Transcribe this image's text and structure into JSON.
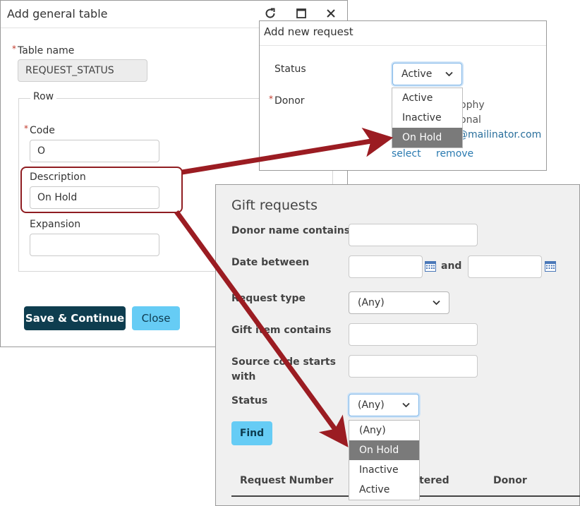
{
  "dialog1": {
    "title": "Add general table",
    "table_name_label": "Table name",
    "table_name_value": "REQUEST_STATUS",
    "row_legend": "Row",
    "code_label": "Code",
    "code_value": "O",
    "description_label": "Description",
    "description_value": "On Hold",
    "expansion_label": "Expansion",
    "expansion_value": "",
    "save_label": "Save & Continue",
    "close_label": "Close",
    "refresh_icon": "refresh-icon",
    "maximize_icon": "maximize-icon",
    "close_icon": "close-icon"
  },
  "dialog2": {
    "title": "Add new request",
    "status_label": "Status",
    "status_value": "Active",
    "donor_label": "Donor",
    "dropdown_options": [
      "Active",
      "Inactive",
      "On Hold"
    ],
    "selected_option": "On Hold",
    "partial_text_1": "ophy",
    "partial_text_2": "onal",
    "partial_email": "@mailinator.com",
    "select_link": "select",
    "remove_link": "remove"
  },
  "panel3": {
    "title": "Gift requests",
    "donor_name_label": "Donor name contains",
    "date_between_label": "Date between",
    "and_label": "and",
    "request_type_label": "Request type",
    "request_type_value": "(Any)",
    "gift_item_label": "Gift item contains",
    "source_code_label": "Source code starts with",
    "status_label": "Status",
    "status_value": "(Any)",
    "dropdown_options": [
      "(Any)",
      "On Hold",
      "Inactive",
      "Active"
    ],
    "selected_option": "On Hold",
    "find_label": "Find",
    "columns": [
      "Request Number",
      "tered",
      "Donor"
    ]
  },
  "colors": {
    "arrow": "#9b1c22",
    "primary_button": "#0e3d4f",
    "secondary_button": "#66ccf5",
    "selected_option": "#7a7a7a"
  }
}
